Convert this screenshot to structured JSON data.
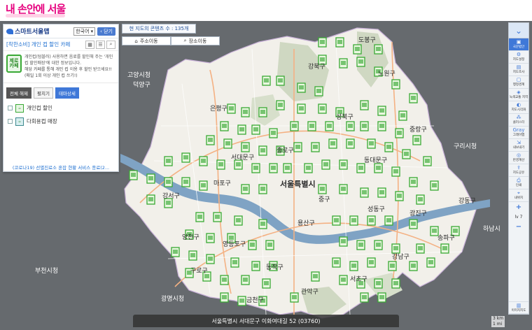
{
  "brand": {
    "title": "내 손안에 서울"
  },
  "panel": {
    "logo": "스마트서울맵",
    "language": "한국어",
    "close_label": "닫기",
    "theme_title": "[착한소비] 개인 컵 할인 카페",
    "icon_label_1": "제로",
    "icon_label_2": "카페",
    "description": "개인컵(텀블러) 사용하면 음료를 할인해 주는 '개인 컵 할인매장'에 대한 정보입니다.",
    "note": "해당 카페를 통해 개인 컵 이용 후 할인 받으세요!! (매일 1회 이상 개인 컵 쓰기!)",
    "buttons": [
      "전체 해제",
      "펼치기",
      "테마상세"
    ],
    "legend": [
      {
        "label": "개인컵 할인"
      },
      {
        "label": "다회용컵 매장"
      }
    ],
    "covid_link": "(코로나19) 선별진료소 혼잡 현황 서비스 종료(2..."
  },
  "map_header": {
    "content_count": "현 지도의 콘텐츠 수 : 135개",
    "move_address": "주소이동",
    "move_place": "장소이동"
  },
  "right_toolbar": {
    "items": [
      "국문법안",
      "지도설정",
      "지도조사",
      "행정경계",
      "녹색교통 지역",
      "지도시각화",
      "클러스터",
      "Gray",
      "그레이맵",
      "내보내기",
      "반경계산",
      "지도공유",
      "인쇄",
      "내위치"
    ],
    "zoom_in": "+",
    "zoom_out": "−",
    "level": "lv 7",
    "bottom": "이미지지도"
  },
  "map_labels": [
    "고양시청",
    "덕양구",
    "도봉구",
    "강북구",
    "노원구",
    "성북구",
    "중랑구",
    "구리시청",
    "서대문구",
    "종로구",
    "동대문구",
    "서울특별시",
    "광진구",
    "강서구",
    "양천구",
    "용산구",
    "성동구",
    "송파구",
    "강동구",
    "영등포구",
    "구로구",
    "동작구",
    "서초구",
    "강남구",
    "관악구",
    "금천구",
    "광명시청",
    "부천시청",
    "마포구",
    "은평구",
    "중구",
    "하남시"
  ],
  "address_bar": "서울특별시 서대문구 이화여대길 52 (03760)",
  "scale": {
    "km": "3 km",
    "mi": "1 mi"
  },
  "colors": {
    "marker_green": "#39a935",
    "marker_fill": "#eaf7e0",
    "river": "#7fa3c4",
    "accent_blue": "#3f78d8",
    "brand_pink": "#e6007e"
  }
}
